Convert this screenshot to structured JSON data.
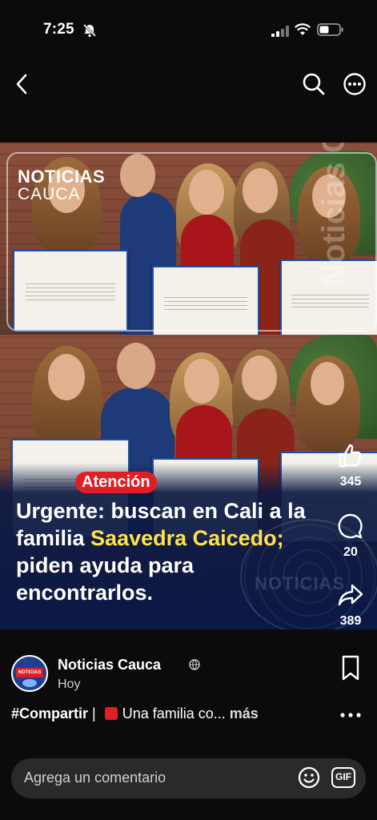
{
  "status_bar": {
    "time": "7:25"
  },
  "post": {
    "media": {
      "brand_line1": "NOTICIAS",
      "brand_line2": "CAUCA",
      "watermark": "Noticias Cauca",
      "globe_mark": "NOTICIAS",
      "badge": "Atención",
      "headline_part1": "Urgente: buscan en Cali a la familia ",
      "headline_highlight": "Saavedra Caicedo;",
      "headline_part2": " piden ayuda para encontrarlos."
    },
    "actions": {
      "likes": "345",
      "comments": "20",
      "shares": "389"
    },
    "author": {
      "name": "Noticias Cauca",
      "time": "Hoy",
      "avatar_text": "NOTICIAS"
    },
    "caption": {
      "tag": "#Compartir",
      "separator": " | ",
      "text": "Una familia co...",
      "more": " más"
    },
    "comment_input": {
      "placeholder": "Agrega un comentario",
      "gif_label": "GIF"
    }
  },
  "colors": {
    "badge": "#e01e26",
    "highlight": "#ffe34a",
    "overlay": "#0c1941"
  }
}
